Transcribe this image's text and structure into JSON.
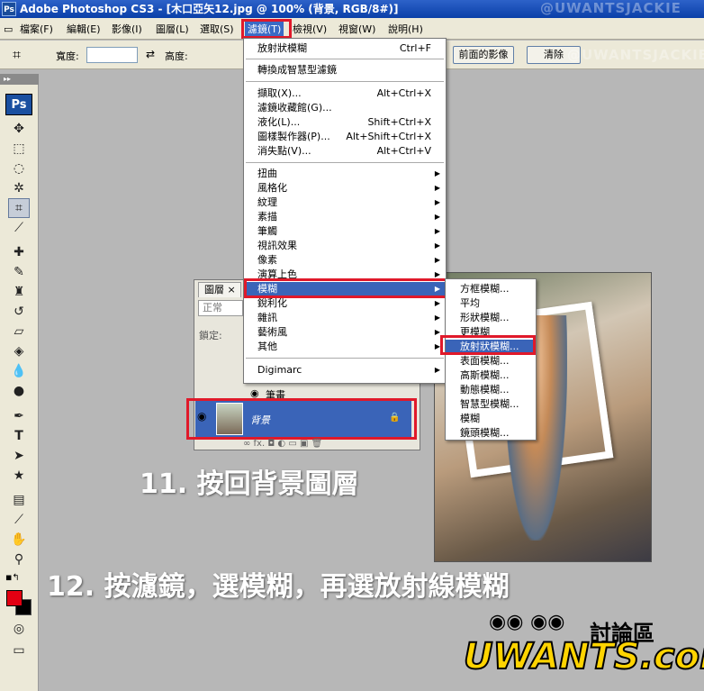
{
  "app": {
    "title": "Adobe Photoshop CS3 - [木口亞矢12.jpg @ 100% (背景, RGB/8#)]",
    "icon": "Ps"
  },
  "menubar": {
    "items": [
      "檔案(F)",
      "編輯(E)",
      "影像(I)",
      "圖層(L)",
      "選取(S)",
      "濾鏡(T)",
      "檢視(V)",
      "視窗(W)",
      "說明(H)"
    ]
  },
  "options": {
    "width_label": "寬度:",
    "height_label": "高度:",
    "front_image_button": "前面的影像",
    "clear_button": "清除"
  },
  "toolbox": {
    "logo": "Ps"
  },
  "filter_menu": {
    "last_filter": {
      "label": "放射狀模糊",
      "shortcut": "Ctrl+F"
    },
    "smart_filter": "轉換成智慧型濾鏡",
    "group2": [
      {
        "label": "擷取(X)...",
        "shortcut": "Alt+Ctrl+X"
      },
      {
        "label": "濾鏡收藏館(G)...",
        "shortcut": ""
      },
      {
        "label": "液化(L)...",
        "shortcut": "Shift+Ctrl+X"
      },
      {
        "label": "圖樣製作器(P)...",
        "shortcut": "Alt+Shift+Ctrl+X"
      },
      {
        "label": "消失點(V)...",
        "shortcut": "Alt+Ctrl+V"
      }
    ],
    "submenus": [
      "扭曲",
      "風格化",
      "紋理",
      "素描",
      "筆觸",
      "視訊效果",
      "像素",
      "演算上色",
      "模糊",
      "銳利化",
      "雜訊",
      "藝術風",
      "其他"
    ],
    "digimarc": "Digimarc"
  },
  "blur_menu": {
    "items": [
      "方框模糊...",
      "平均",
      "形狀模糊...",
      "更模糊",
      "放射狀模糊...",
      "表面模糊...",
      "高斯模糊...",
      "動態模糊...",
      "智慧型模糊...",
      "模糊",
      "鏡頭模糊..."
    ]
  },
  "layers_panel": {
    "tab": "圖層",
    "blend_mode": "正常",
    "lock_label": "鎖定:",
    "pen_layer": "筆畫",
    "background_layer": "背景",
    "footer": "fx."
  },
  "captions": {
    "step11": "11. 按回背景圖層",
    "step12": "12. 按濾鏡，選模糊，再選放射線模糊"
  },
  "logo": {
    "forum": "討論區",
    "brand": "UWANTS.com"
  },
  "watermark": "@UWANTSJACKIE"
}
